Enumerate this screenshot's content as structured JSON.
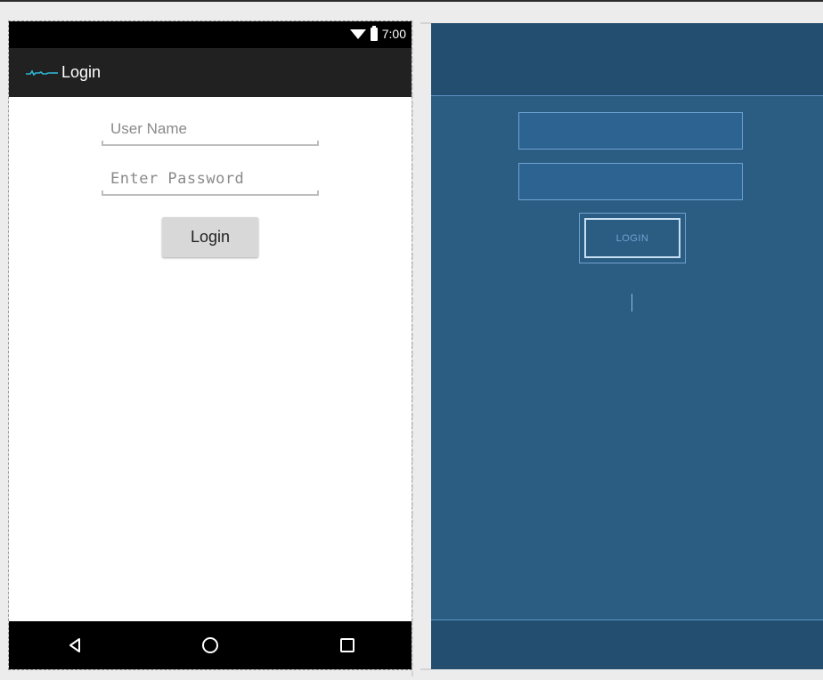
{
  "status_bar": {
    "time": "7:00"
  },
  "action_bar": {
    "title": "Login"
  },
  "form": {
    "username_placeholder": "User Name",
    "password_placeholder": "Enter Password",
    "login_label": "Login"
  },
  "blueprint": {
    "login_label": "LOGIN"
  },
  "icons": {
    "wifi": "wifi-icon",
    "battery": "battery-icon",
    "app": "app-icon",
    "back": "back-icon",
    "home": "home-icon",
    "recent": "recent-apps-icon"
  },
  "colors": {
    "status_bar": "#000000",
    "action_bar": "#212121",
    "button": "#d8d8d8",
    "blueprint_bg": "#2b5c82",
    "blueprint_line": "#6fa3d2"
  }
}
